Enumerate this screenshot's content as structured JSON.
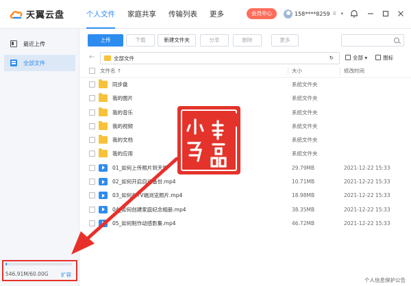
{
  "app": {
    "name": "天翼云盘"
  },
  "nav": {
    "items": [
      "个人文件",
      "家庭共享",
      "传输列表",
      "更多"
    ]
  },
  "header": {
    "vip": "会员中心",
    "phone": "158****8259"
  },
  "sidebar": {
    "items": [
      "最近上传",
      "全部文件"
    ],
    "active": 1
  },
  "storage": {
    "used": "546.91M/60.00G",
    "expand": "扩容",
    "fraction": 0.009
  },
  "toolbar": {
    "upload": "上传",
    "download": "下载",
    "new_folder": "新建文件夹",
    "share": "分享",
    "delete": "删除",
    "more": "更多"
  },
  "path": {
    "current": "全部文件"
  },
  "view": {
    "sort": "全部",
    "icons": "图标"
  },
  "table": {
    "headers": {
      "name": "文件名",
      "size": "大小",
      "time": "修改时间"
    },
    "rows": [
      {
        "type": "folder",
        "name": "同步盘",
        "size": "系统文件夹",
        "time": ""
      },
      {
        "type": "folder",
        "name": "我的图片",
        "size": "系统文件夹",
        "time": ""
      },
      {
        "type": "folder",
        "name": "我的音乐",
        "size": "系统文件夹",
        "time": ""
      },
      {
        "type": "folder",
        "name": "我的视频",
        "size": "系统文件夹",
        "time": ""
      },
      {
        "type": "folder",
        "name": "我的文档",
        "size": "系统文件夹",
        "time": ""
      },
      {
        "type": "folder",
        "name": "我的应用",
        "size": "系统文件夹",
        "time": ""
      },
      {
        "type": "video",
        "name": "01_如何上传照片到天翼",
        "size": "29.79MB",
        "time": "2021-12-22 15:33"
      },
      {
        "type": "video",
        "name": "02_如何开启自动备份.mp4",
        "size": "10.71MB",
        "time": "2021-12-22 15:33"
      },
      {
        "type": "video",
        "name": "03_如何在TV端浏览照片.mp4",
        "size": "18.98MB",
        "time": "2021-12-22 15:33"
      },
      {
        "type": "video",
        "name": "04_如何创建家庭纪念相册.mp4",
        "size": "38.35MB",
        "time": "2021-12-22 15:33"
      },
      {
        "type": "video",
        "name": "05_如何制作动感影集.mp4",
        "size": "46.72MB",
        "time": "2021-12-22 15:33"
      }
    ]
  },
  "stamp": {
    "text": "小码精品"
  },
  "footer": {
    "privacy": "个人信息保护公告"
  },
  "colors": {
    "accent": "#2d8cf0",
    "vip": "#ff6d5b",
    "stamp": "#e4332a",
    "folder": "#f7c23a"
  },
  "icons": {
    "logo": "cloud-logo-icon",
    "settings": "bell-icon",
    "minimize": "minimize-icon",
    "maximize": "maximize-icon",
    "close": "close-icon",
    "search": "search-icon",
    "refresh": "refresh-icon",
    "back": "back-arrow-icon"
  }
}
